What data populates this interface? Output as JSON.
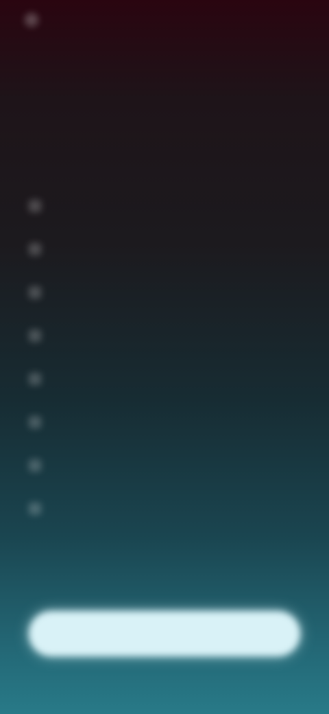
{
  "header": {
    "back_label": ""
  },
  "title": "",
  "subtitle": "",
  "options": [
    {
      "label": ""
    },
    {
      "label": ""
    },
    {
      "label": ""
    },
    {
      "label": ""
    },
    {
      "label": ""
    },
    {
      "label": ""
    },
    {
      "label": ""
    },
    {
      "label": ""
    }
  ],
  "primary_button": {
    "label": ""
  },
  "colors": {
    "background_top": "#2a0510",
    "background_bottom": "#287a88",
    "button_fill": "#d9f2f7"
  },
  "icons": {
    "top_left": "circle-icon",
    "option_marker": "checkbox-icon"
  }
}
